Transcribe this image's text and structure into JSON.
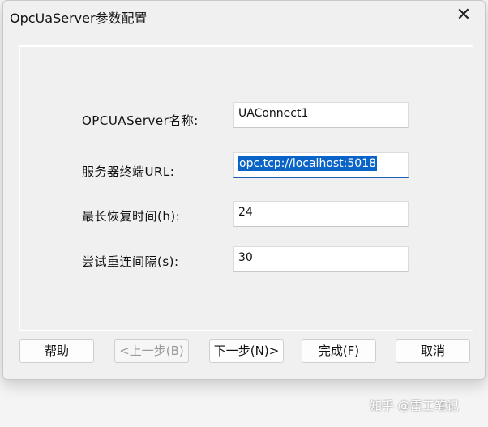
{
  "window": {
    "title": "OpcUaServer参数配置",
    "close_glyph": "✕"
  },
  "form": {
    "server_name_label": "OPCUAServer名称:",
    "server_name_value": "UAConnect1",
    "url_label": "服务器终端URL:",
    "url_value": "opc.tcp://localhost:5018",
    "max_recovery_label": "最长恢复时间(h):",
    "max_recovery_value": "24",
    "retry_interval_label": "尝试重连间隔(s):",
    "retry_interval_value": "30"
  },
  "buttons": {
    "help": "帮助",
    "prev": "<上一步(B)",
    "next": "下一步(N)>",
    "finish": "完成(F)",
    "cancel": "取消"
  },
  "watermark": "知乎 @雷工笔记",
  "colors": {
    "selection": "#0a64c8",
    "background": "#f0f0f0"
  }
}
